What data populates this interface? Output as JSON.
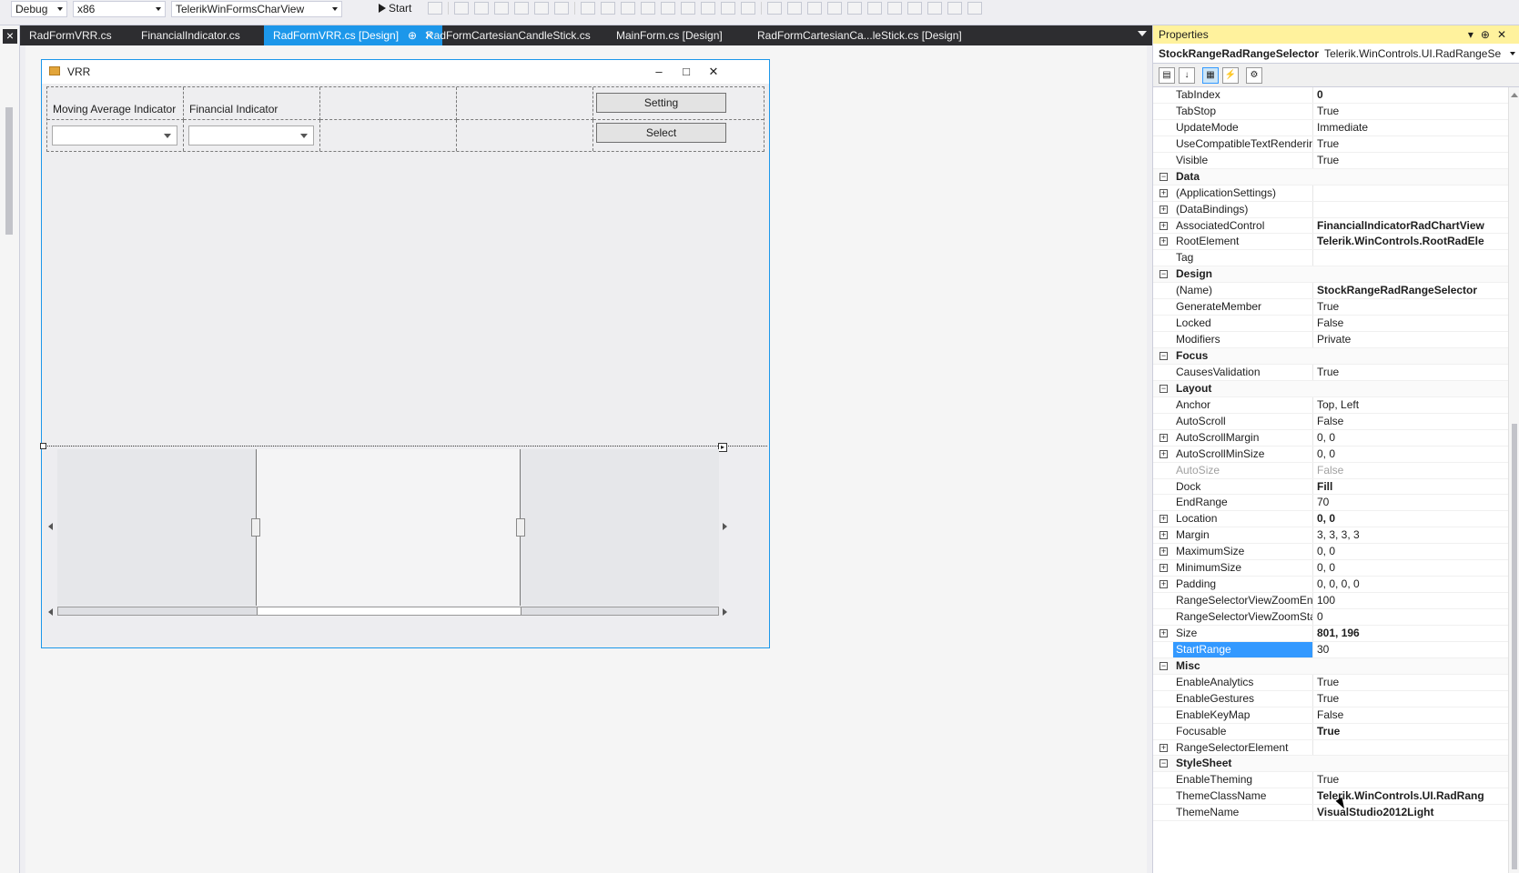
{
  "toolbar": {
    "config": "Debug",
    "platform": "x86",
    "project": "TelerikWinFormsCharView",
    "start_label": "Start"
  },
  "tabs": [
    {
      "label": "RadFormVRR.cs"
    },
    {
      "label": "FinancialIndicator.cs"
    },
    {
      "label": "RadFormVRR.cs [Design]",
      "pin": "⊕",
      "close": "✕"
    },
    {
      "label": "RadFormCartesianCandleStick.cs"
    },
    {
      "label": "MainForm.cs [Design]"
    },
    {
      "label": "RadFormCartesianCa...leStick.cs [Design]"
    }
  ],
  "form": {
    "caption": "VRR",
    "min": "–",
    "max": "□",
    "close": "✕",
    "label_moving_average": "Moving Average Indicator",
    "label_financial": "Financial Indicator",
    "setting_button": "Setting",
    "select_button": "Select"
  },
  "range_selector": {
    "start": 30,
    "end": 70
  },
  "properties": {
    "title": "Properties",
    "object_name": "StockRangeRadRangeSelector",
    "object_type": "Telerik.WinControls.UI.RadRangeSe",
    "rows": [
      {
        "kind": "prop",
        "name": "TabIndex",
        "value": "0",
        "bold": true
      },
      {
        "kind": "prop",
        "name": "TabStop",
        "value": "True"
      },
      {
        "kind": "prop",
        "name": "UpdateMode",
        "value": "Immediate"
      },
      {
        "kind": "prop",
        "name": "UseCompatibleTextRendering",
        "value": "True"
      },
      {
        "kind": "prop",
        "name": "Visible",
        "value": "True"
      },
      {
        "kind": "cat",
        "name": "Data"
      },
      {
        "kind": "prop",
        "name": "(ApplicationSettings)",
        "value": "",
        "expand": true
      },
      {
        "kind": "prop",
        "name": "(DataBindings)",
        "value": "",
        "expand": true
      },
      {
        "kind": "prop",
        "name": "AssociatedControl",
        "value": "FinancialIndicatorRadChartView",
        "expand": true,
        "bold": true
      },
      {
        "kind": "prop",
        "name": "RootElement",
        "value": "Telerik.WinControls.RootRadEle",
        "expand": true,
        "bold": true
      },
      {
        "kind": "prop",
        "name": "Tag",
        "value": ""
      },
      {
        "kind": "cat",
        "name": "Design"
      },
      {
        "kind": "prop",
        "name": "(Name)",
        "value": "StockRangeRadRangeSelector",
        "bold": true
      },
      {
        "kind": "prop",
        "name": "GenerateMember",
        "value": "True"
      },
      {
        "kind": "prop",
        "name": "Locked",
        "value": "False"
      },
      {
        "kind": "prop",
        "name": "Modifiers",
        "value": "Private"
      },
      {
        "kind": "cat",
        "name": "Focus"
      },
      {
        "kind": "prop",
        "name": "CausesValidation",
        "value": "True"
      },
      {
        "kind": "cat",
        "name": "Layout"
      },
      {
        "kind": "prop",
        "name": "Anchor",
        "value": "Top, Left"
      },
      {
        "kind": "prop",
        "name": "AutoScroll",
        "value": "False"
      },
      {
        "kind": "prop",
        "name": "AutoScrollMargin",
        "value": "0, 0",
        "expand": true
      },
      {
        "kind": "prop",
        "name": "AutoScrollMinSize",
        "value": "0, 0",
        "expand": true
      },
      {
        "kind": "prop",
        "name": "AutoSize",
        "value": "False",
        "dim": true
      },
      {
        "kind": "prop",
        "name": "Dock",
        "value": "Fill",
        "bold": true
      },
      {
        "kind": "prop",
        "name": "EndRange",
        "value": "70"
      },
      {
        "kind": "prop",
        "name": "Location",
        "value": "0, 0",
        "expand": true,
        "bold": true
      },
      {
        "kind": "prop",
        "name": "Margin",
        "value": "3, 3, 3, 3",
        "expand": true
      },
      {
        "kind": "prop",
        "name": "MaximumSize",
        "value": "0, 0",
        "expand": true
      },
      {
        "kind": "prop",
        "name": "MinimumSize",
        "value": "0, 0",
        "expand": true
      },
      {
        "kind": "prop",
        "name": "Padding",
        "value": "0, 0, 0, 0",
        "expand": true
      },
      {
        "kind": "prop",
        "name": "RangeSelectorViewZoomEnd",
        "value": "100"
      },
      {
        "kind": "prop",
        "name": "RangeSelectorViewZoomStart",
        "value": "0"
      },
      {
        "kind": "prop",
        "name": "Size",
        "value": "801, 196",
        "expand": true,
        "bold": true
      },
      {
        "kind": "prop",
        "name": "StartRange",
        "value": "30",
        "selected": true
      },
      {
        "kind": "cat",
        "name": "Misc"
      },
      {
        "kind": "prop",
        "name": "EnableAnalytics",
        "value": "True"
      },
      {
        "kind": "prop",
        "name": "EnableGestures",
        "value": "True"
      },
      {
        "kind": "prop",
        "name": "EnableKeyMap",
        "value": "False"
      },
      {
        "kind": "prop",
        "name": "Focusable",
        "value": "True",
        "bold": true
      },
      {
        "kind": "prop",
        "name": "RangeSelectorElement",
        "value": "",
        "expand": true
      },
      {
        "kind": "cat",
        "name": "StyleSheet"
      },
      {
        "kind": "prop",
        "name": "EnableTheming",
        "value": "True"
      },
      {
        "kind": "prop",
        "name": "ThemeClassName",
        "value": "Telerik.WinControls.UI.RadRang",
        "bold": true
      },
      {
        "kind": "prop",
        "name": "ThemeName",
        "value": "VisualStudio2012Light",
        "bold": true
      }
    ]
  }
}
